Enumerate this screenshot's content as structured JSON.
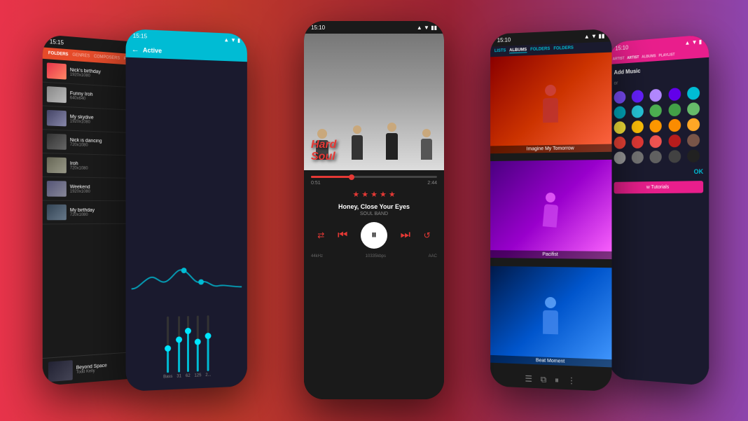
{
  "background": {
    "gradient_start": "#e8334a",
    "gradient_end": "#8e44ad"
  },
  "phone1": {
    "status_time": "15:15",
    "header_tabs": [
      "FOLDERS",
      "GENRES",
      "COMPOSERS",
      "P..."
    ],
    "items": [
      {
        "title": "Nick's birthday",
        "size": "1920x1080",
        "thumb_color": "#e8334a"
      },
      {
        "title": "Funny Iroh",
        "size": "640x640",
        "thumb_color": "#888"
      },
      {
        "title": "My skydive",
        "size": "1920x1080",
        "thumb_color": "#558"
      },
      {
        "title": "Nick is dancing",
        "size": "720x1080",
        "thumb_color": "#444"
      },
      {
        "title": "Iroh",
        "size": "720x1080",
        "thumb_color": "#777"
      },
      {
        "title": "Weekend",
        "size": "1920x1080",
        "thumb_color": "#668"
      },
      {
        "title": "My birthday",
        "size": "720x1080",
        "thumb_color": "#446"
      },
      {
        "title": "Beyond Space",
        "size": "",
        "thumb_color": "#334",
        "subtitle": "Todd Kelly"
      }
    ]
  },
  "phone2": {
    "status_time": "15:15",
    "header_title": "Active",
    "eq_labels": [
      "Bass",
      "31",
      "62",
      "125",
      "2..."
    ],
    "eq_heights": [
      40,
      55,
      70,
      50,
      60
    ]
  },
  "phone3": {
    "status_time": "15:10",
    "album_title_line1": "Hard",
    "album_title_line2": "Soul",
    "song_title": "Honey, Close Your Eyes",
    "song_artist": "SOUL BAND",
    "progress_current": "0:51",
    "progress_total": "2:44",
    "progress_percent": 32,
    "stars": 5,
    "audio_format": "44kHz",
    "audio_bitrate": "10335kbps",
    "audio_codec": "AAC",
    "controls": {
      "shuffle": "⇄",
      "prev": "⏮",
      "pause": "⏸",
      "next": "⏭",
      "repeat": "⇌"
    }
  },
  "phone4": {
    "status_time": "15:10",
    "tabs": [
      "LISTS",
      "ALBUMS",
      "FOLDERS",
      "FOLDERS"
    ],
    "albums": [
      {
        "name": "Imagine My Tomorrow",
        "color1": "#8B0000",
        "color2": "#ff6644"
      },
      {
        "name": "Pacifist",
        "color1": "#4a0080",
        "color2": "#ff66ff"
      },
      {
        "name": "Beat Moment",
        "color1": "#001a4a",
        "color2": "#4499ff"
      }
    ]
  },
  "phone5": {
    "status_time": "15:10",
    "tabs": [
      "ARTIST",
      "ARTIST",
      "ALBUMS",
      "PLAYLIST"
    ],
    "add_music_label": "Add Music",
    "color_label": "or",
    "ok_label": "OK",
    "tutorials_label": "w Tutorials",
    "colors": [
      "#7c4dff",
      "#651fff",
      "#b388ff",
      "#6200ea",
      "#aa00ff",
      "#00bcd4",
      "#00acc1",
      "#26c6da",
      "#00838f",
      "#006064",
      "#4caf50",
      "#43a047",
      "#66bb6a",
      "#2e7d32",
      "#1b5e20",
      "#ff9800",
      "#fb8c00",
      "#ffa726",
      "#e65100",
      "#bf360c",
      "#f44336",
      "#e53935",
      "#ef5350",
      "#b71c1c",
      "#c62828"
    ]
  }
}
